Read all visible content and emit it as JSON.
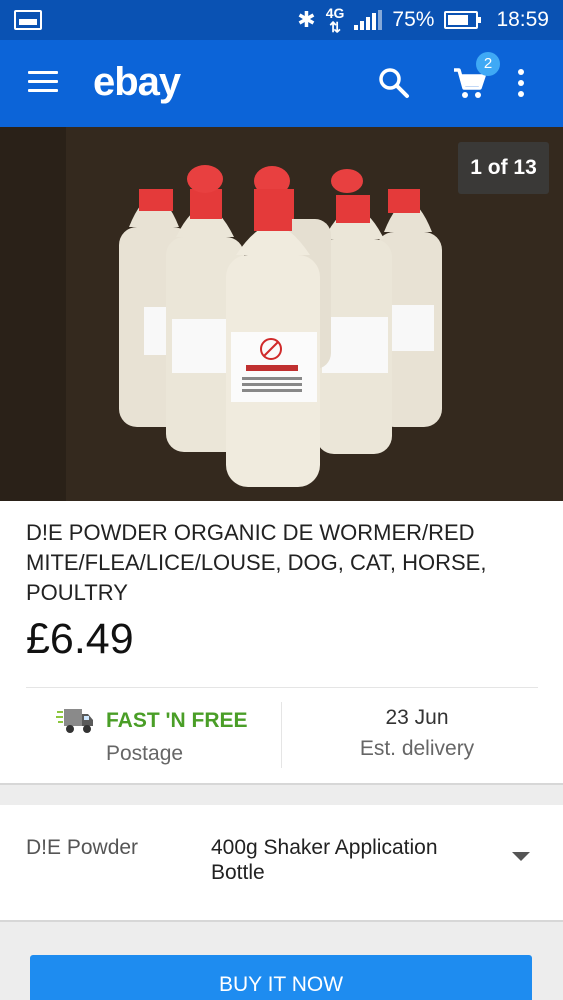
{
  "status_bar": {
    "network": "4G",
    "battery": "75%",
    "time": "18:59",
    "icons": [
      "image-notification-icon",
      "bluetooth-icon",
      "network-4g-icon",
      "signal-icon",
      "battery-icon"
    ]
  },
  "app_bar": {
    "logo": "ebay",
    "cart_count": "2",
    "icons": [
      "hamburger-menu-icon",
      "search-icon",
      "cart-icon",
      "more-vert-icon"
    ]
  },
  "gallery": {
    "counter": "1 of 13"
  },
  "product": {
    "title": "D!E POWDER ORGANIC DE WORMER/RED MITE/FLEA/LICE/LOUSE, DOG, CAT, HORSE, POULTRY",
    "price": "£6.49"
  },
  "shipping": {
    "method": "FAST 'N FREE",
    "method_sub": "Postage",
    "delivery_date": "23 Jun",
    "delivery_label": "Est. delivery"
  },
  "variation": {
    "label": "D!E Powder",
    "selected": "400g Shaker Application Bottle"
  },
  "actions": {
    "buy_now": "BUY IT NOW"
  },
  "colors": {
    "status_bar": "#0a52b3",
    "app_bar": "#0c64d8",
    "fast_free_green": "#4a9e27",
    "buy_button": "#1e8cf0",
    "badge": "#3fa9f5"
  }
}
